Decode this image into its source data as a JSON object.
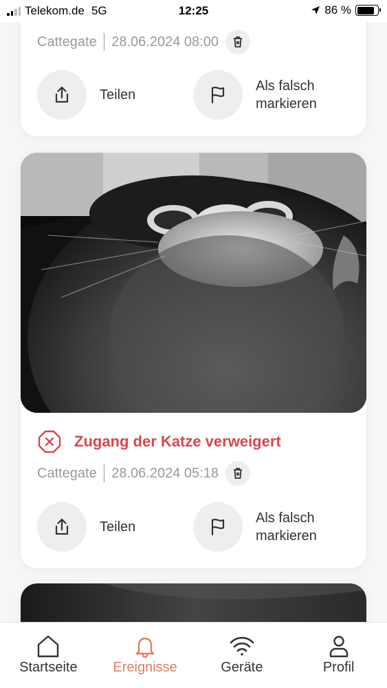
{
  "status_bar": {
    "carrier": "Telekom.de",
    "network": "5G",
    "time": "12:25",
    "battery": "86 %"
  },
  "events": [
    {
      "camera": "Cattegate",
      "datetime": "28.06.2024 08:00",
      "share_label": "Teilen",
      "flag_label_line1": "Als falsch",
      "flag_label_line2": "markieren"
    },
    {
      "status": "Zugang der Katze verweigert",
      "status_color": "#d6474d",
      "camera": "Cattegate",
      "datetime": "28.06.2024 05:18",
      "share_label": "Teilen",
      "flag_label_line1": "Als falsch",
      "flag_label_line2": "markieren"
    }
  ],
  "tabs": [
    {
      "label": "Startseite",
      "icon": "home-icon"
    },
    {
      "label": "Ereignisse",
      "icon": "bell-icon",
      "active": true
    },
    {
      "label": "Geräte",
      "icon": "wifi-icon"
    },
    {
      "label": "Profil",
      "icon": "person-icon"
    }
  ],
  "colors": {
    "accent": "#e37d5e",
    "denied": "#d6474d",
    "muted_text": "#9a9a9a"
  }
}
